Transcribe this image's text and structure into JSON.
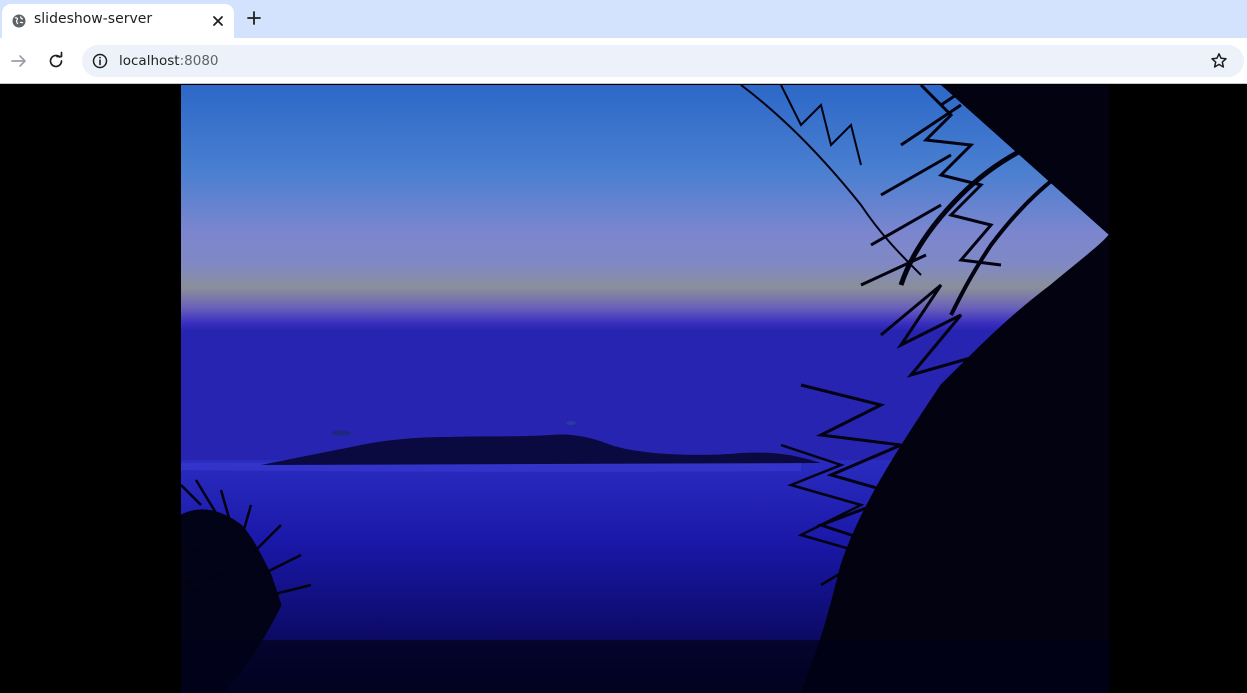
{
  "browser": {
    "tab": {
      "title": "slideshow-server",
      "favicon_icon": "globe-icon",
      "close_icon": "close-icon"
    },
    "new_tab_icon": "plus-icon",
    "toolbar": {
      "back_icon": "arrow-right-icon",
      "reload_icon": "reload-icon",
      "site_info_icon": "info-icon",
      "url_host": "localhost",
      "url_port": ":8080",
      "bookmark_icon": "star-icon"
    },
    "colors": {
      "tabstrip": "#d3e3fd",
      "omnibox": "#edf2fa"
    }
  },
  "slideshow": {
    "image": {
      "subject": "tropical sunset over sea with island silhouette and palm fronds",
      "colors": {
        "sky_top": "#2d68c8",
        "sky_mid": "#7c86cf",
        "horizon": "#8a8f9a",
        "sea": "#1a18a8",
        "sea_dark": "#050430"
      }
    }
  }
}
